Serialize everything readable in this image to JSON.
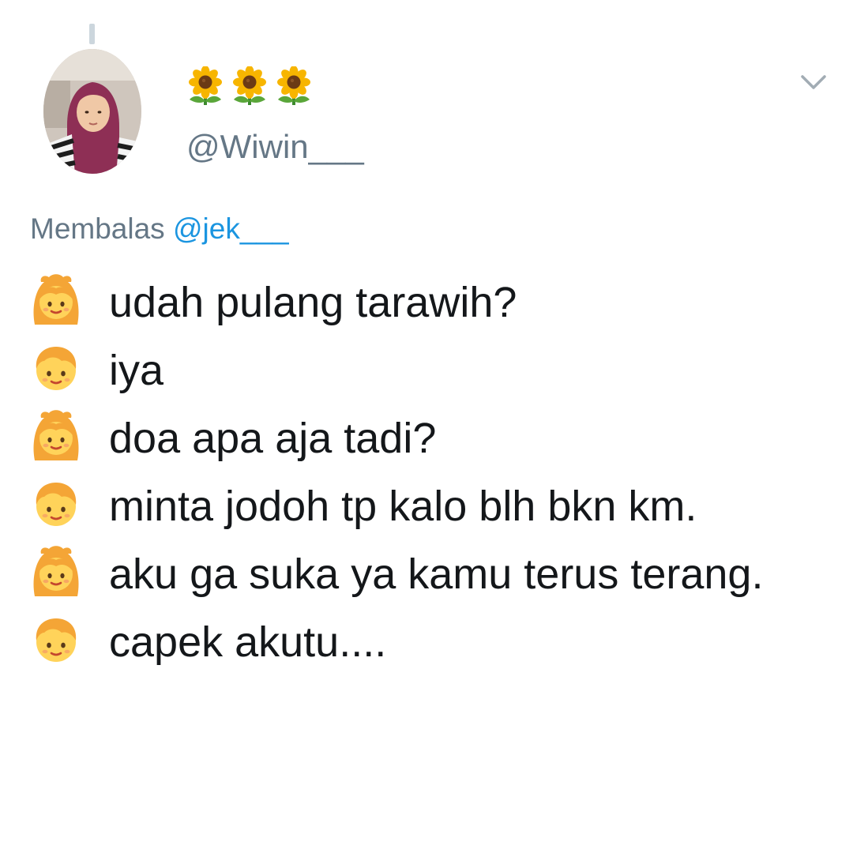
{
  "tweet": {
    "display_name_icons": [
      "sunflower-icon",
      "sunflower-icon",
      "sunflower-icon"
    ],
    "handle": "@Wiwin___",
    "reply_prefix": "Membalas",
    "reply_to": "@jek___",
    "lines": [
      {
        "speaker_icon": "girl-emoji-icon",
        "text": "udah pulang tarawih?"
      },
      {
        "speaker_icon": "boy-emoji-icon",
        "text": "iya"
      },
      {
        "speaker_icon": "girl-emoji-icon",
        "text": "doa apa aja tadi?"
      },
      {
        "speaker_icon": "boy-emoji-icon",
        "text": "minta jodoh tp kalo blh bkn km."
      },
      {
        "speaker_icon": "girl-emoji-icon",
        "text": "aku ga suka ya kamu terus terang."
      },
      {
        "speaker_icon": "boy-emoji-icon",
        "text": "capek akutu...."
      }
    ]
  },
  "colors": {
    "text": "#14171a",
    "secondary_text": "#657786",
    "mention_link": "#1b95e0",
    "thread_line": "#ccd6dd"
  },
  "icons": {
    "menu_caret": "chevron-down-icon",
    "avatar": "avatar-photo"
  }
}
